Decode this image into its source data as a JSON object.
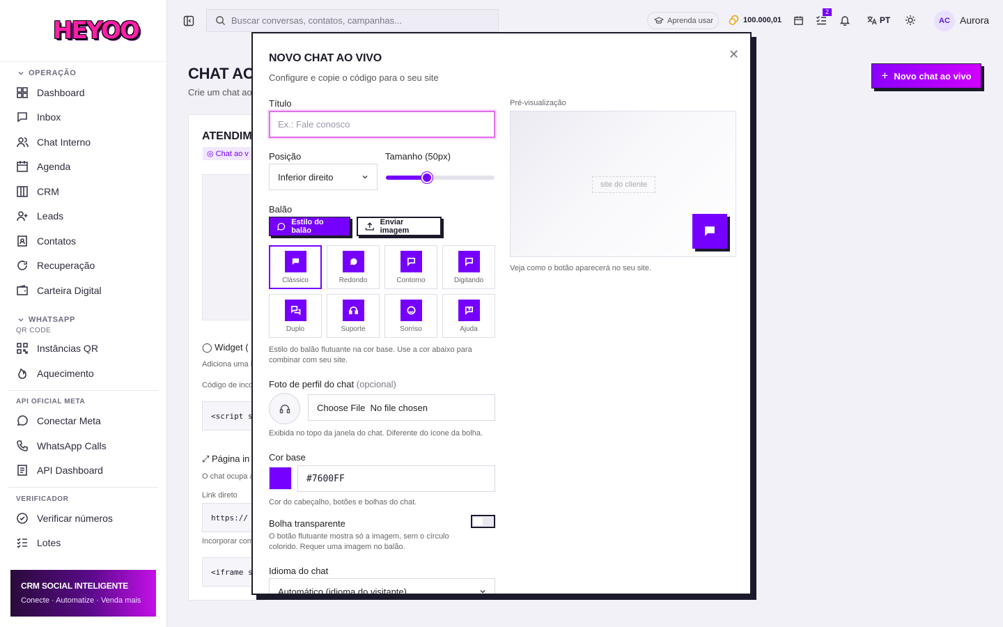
{
  "brand": {
    "logo_text": "HEYOO"
  },
  "sidebar": {
    "sections": [
      {
        "title": "OPERAÇÃO",
        "items": [
          "Dashboard",
          "Inbox",
          "Chat Interno",
          "Agenda",
          "CRM",
          "Leads",
          "Contatos",
          "Recuperação",
          "Carteira Digital"
        ]
      },
      {
        "title": "WHATSAPP",
        "subtitle": "QR CODE",
        "items": [
          "Instâncias QR",
          "Aquecimento"
        ]
      },
      {
        "title": "API OFICIAL META",
        "items": [
          "Conectar Meta",
          "WhatsApp Calls",
          "API Dashboard"
        ]
      },
      {
        "title": "VERIFICADOR",
        "items": [
          "Verificar números",
          "Lotes"
        ]
      }
    ],
    "promo": {
      "title": "CRM SOCIAL INTELIGENTE",
      "subtitle": "Conecte · Automatize · Venda mais"
    }
  },
  "topbar": {
    "search_placeholder": "Buscar conversas, contatos, campanhas...",
    "learn_label": "Aprenda usar",
    "coins": "100.000,01",
    "tasks_badge": "2",
    "language": "PT",
    "avatar_initials": "AC",
    "user_name": "Aurora"
  },
  "page": {
    "title": "CHAT AO",
    "subtitle": "Crie um chat ao",
    "new_button": "Novo chat ao vivo",
    "card": {
      "heading": "ATENDIM",
      "chip": "Chat ao v",
      "widget_label": "Widget (",
      "widget_desc": "Adiciona uma b",
      "code_label": "Código de inco",
      "script_code": "<script s",
      "page_label": "Página in",
      "page_desc": "O chat ocupa a",
      "link_label": "Link direto",
      "link_value": "https://",
      "embed_label": "Incorporar com",
      "iframe_code": "<iframe s"
    }
  },
  "modal": {
    "title": "NOVO CHAT AO VIVO",
    "subtitle": "Configure e copie o código para o seu site",
    "title_label": "Título",
    "title_placeholder": "Ex.: Fale conosco",
    "position_label": "Posição",
    "position_value": "Inferior direito",
    "size_label": "Tamanho (50px)",
    "size_fraction": 0.38,
    "balloon_label": "Balão",
    "tab_style": "Estilo do balão",
    "tab_upload": "Enviar imagem",
    "styles": [
      "Clássico",
      "Redondo",
      "Contorno",
      "Digitando",
      "Duplo",
      "Suporte",
      "Sorriso",
      "Ajuda"
    ],
    "selected_style": "Clássico",
    "style_help": "Estilo do balão flutuante na cor base. Use a cor abaixo para combinar com seu site.",
    "photo_label": "Foto de perfil do chat",
    "photo_optional": "(opcional)",
    "file_text": "Choose File  No file chosen",
    "photo_help": "Exibida no topo da janela do chat. Diferente do ícone da bolha.",
    "color_label": "Cor base",
    "color_value": "#7600FF",
    "color_help": "Cor do cabeçalho, botões e bolhas do chat.",
    "transparent_label": "Bolha transparente",
    "transparent_help": "O botão flutuante mostra só a imagem, sem o círculo colorido. Requer uma imagem no balão.",
    "language_label": "Idioma do chat",
    "language_value": "Automático (idioma do visitante)",
    "preview_label": "Pré-visualização",
    "preview_site": "site do cliente",
    "preview_help": "Veja como o botão aparecerá no seu site."
  },
  "colors": {
    "accent": "#7600ff",
    "pink": "#e16fe8",
    "dark": "#1a1a2a"
  }
}
